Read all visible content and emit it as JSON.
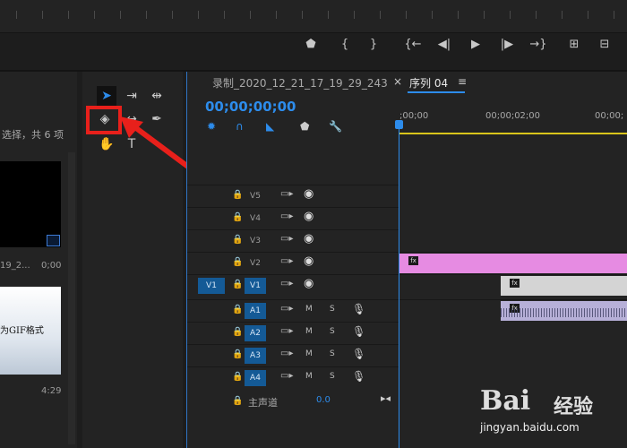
{
  "program_controls": [
    {
      "icon": "marker-icon",
      "glyph": "⬟"
    },
    {
      "icon": "mark-in-icon",
      "glyph": "{"
    },
    {
      "icon": "mark-out-icon",
      "glyph": "}"
    },
    {
      "icon": "go-to-in-icon",
      "glyph": "{←"
    },
    {
      "icon": "step-back-icon",
      "glyph": "◀|"
    },
    {
      "icon": "play-icon",
      "glyph": "▶"
    },
    {
      "icon": "step-forward-icon",
      "glyph": "|▶"
    },
    {
      "icon": "go-to-out-icon",
      "glyph": "→}"
    },
    {
      "icon": "lift-icon",
      "glyph": "⊞"
    },
    {
      "icon": "extract-icon",
      "glyph": "⊟"
    }
  ],
  "project_panel": {
    "selection_text": "选择，共 6 项",
    "items": [
      {
        "name": "19_2...",
        "duration": "0;00"
      },
      {
        "thumb_text": "为GIF格式",
        "duration": "4:29"
      }
    ]
  },
  "tools": [
    "selection-tool",
    "track-select-tool",
    "ripple-edit-tool",
    "razor-tool",
    "slip-tool",
    "pen-tool",
    "hand-tool",
    "type-tool"
  ],
  "timeline": {
    "tabs": [
      {
        "label": "录制_2020_12_21_17_19_29_243"
      },
      {
        "label": "×"
      },
      {
        "label": "序列 04"
      },
      {
        "label": "≡"
      }
    ],
    "timecode": "00;00;00;00",
    "ruler_labels": [
      ";00;00",
      "00;00;02;00",
      "00;00;"
    ],
    "video_tracks": [
      {
        "name": "V5"
      },
      {
        "name": "V4"
      },
      {
        "name": "V3"
      },
      {
        "name": "V2"
      },
      {
        "name": "V1",
        "source": "V1"
      }
    ],
    "audio_tracks": [
      {
        "name": "A1",
        "m": "M",
        "s": "S"
      },
      {
        "name": "A2",
        "m": "M",
        "s": "S"
      },
      {
        "name": "A3",
        "m": "M",
        "s": "S"
      },
      {
        "name": "A4",
        "m": "M",
        "s": "S"
      }
    ],
    "master": {
      "label": "主声道",
      "value": "0.0"
    },
    "colors": {
      "clip_pink": "#e68be2",
      "accent": "#2d8ceb",
      "in_out_bar": "#d9c51b"
    }
  },
  "annotation": {
    "color": "#e8201b"
  },
  "watermark": {
    "brand": "Bai",
    "brand_cn": "经验",
    "url": "jingyan.baidu.com"
  }
}
